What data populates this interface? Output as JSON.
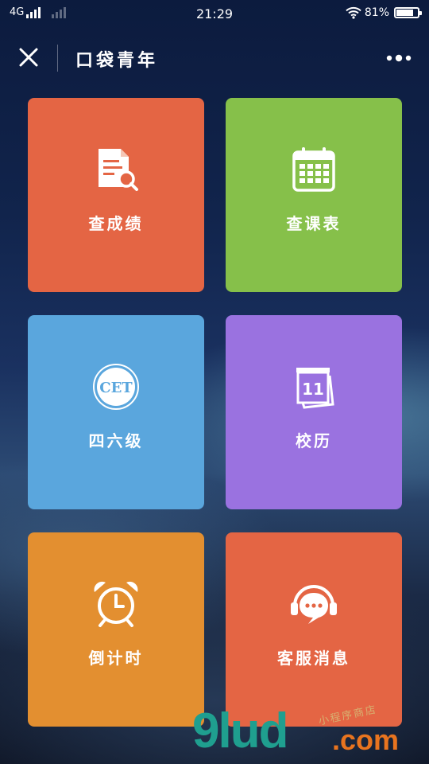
{
  "status_bar": {
    "network": "4G",
    "time": "21:29",
    "battery_percent": "81%",
    "battery_level": 0.81,
    "icons": [
      "signal-icon",
      "signal-dim-icon",
      "wifi-icon",
      "battery-icon"
    ]
  },
  "nav": {
    "title": "口袋青年",
    "close_icon": "close-icon",
    "more_icon": "more-icon"
  },
  "tiles": [
    {
      "label": "查成绩",
      "color": "#e46544",
      "icon": "grade-search-icon"
    },
    {
      "label": "查课表",
      "color": "#86c04a",
      "icon": "calendar-icon"
    },
    {
      "label": "四六级",
      "color": "#5aa6dd",
      "icon": "cet-icon",
      "icon_text": "CET"
    },
    {
      "label": "校历",
      "color": "#9a72e0",
      "icon": "tear-calendar-icon",
      "icon_text": "11"
    },
    {
      "label": "倒计时",
      "color": "#e38f30",
      "icon": "alarm-clock-icon"
    },
    {
      "label": "客服消息",
      "color": "#e46544",
      "icon": "headset-chat-icon"
    }
  ],
  "watermark": {
    "brand": "9lud",
    "suffix": ".com",
    "tagline": "小程序商店"
  }
}
